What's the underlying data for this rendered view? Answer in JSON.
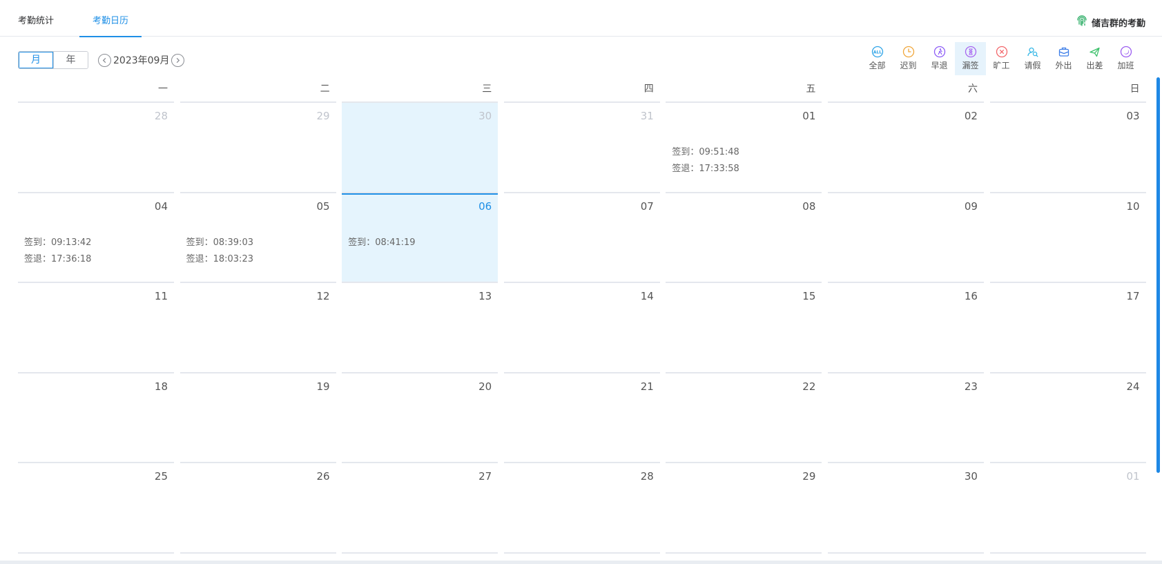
{
  "tabs": [
    {
      "label": "考勤统计"
    },
    {
      "label": "考勤日历"
    }
  ],
  "owner_label": "储吉群的考勤",
  "view_toggle": {
    "month": "月",
    "year": "年",
    "selected": "月"
  },
  "month_label": "2023年09月",
  "filters": [
    {
      "label": "全部",
      "icon": "all-icon",
      "color": "#2fa4e7",
      "active": false
    },
    {
      "label": "迟到",
      "icon": "clock-icon",
      "color": "#f0a63a",
      "active": false
    },
    {
      "label": "早退",
      "icon": "running-icon",
      "color": "#8d5cf6",
      "active": false
    },
    {
      "label": "漏签",
      "icon": "hourglass-icon",
      "color": "#a865f0",
      "active": true
    },
    {
      "label": "旷工",
      "icon": "close-circle-icon",
      "color": "#f2666a",
      "active": false
    },
    {
      "label": "请假",
      "icon": "search-person-icon",
      "color": "#37b7e6",
      "active": false
    },
    {
      "label": "外出",
      "icon": "briefcase-icon",
      "color": "#3d7ee8",
      "active": false
    },
    {
      "label": "出差",
      "icon": "plane-icon",
      "color": "#3cc06a",
      "active": false
    },
    {
      "label": "加班",
      "icon": "moon-icon",
      "color": "#9b5cf0",
      "active": false
    }
  ],
  "weekdays": [
    "一",
    "二",
    "三",
    "四",
    "五",
    "六",
    "日"
  ],
  "weeks": [
    [
      {
        "day": "28",
        "other": true
      },
      {
        "day": "29",
        "other": true
      },
      {
        "day": "30",
        "other": true,
        "selected": true
      },
      {
        "day": "31",
        "other": true
      },
      {
        "day": "01",
        "records": [
          "签到：09:51:48",
          "签退：17:33:58"
        ]
      },
      {
        "day": "02"
      },
      {
        "day": "03"
      }
    ],
    [
      {
        "day": "04",
        "records": [
          "签到：09:13:42",
          "签退：17:36:18"
        ]
      },
      {
        "day": "05",
        "records": [
          "签到：08:39:03",
          "签退：18:03:23"
        ]
      },
      {
        "day": "06",
        "today": true,
        "records": [
          "签到：08:41:19"
        ]
      },
      {
        "day": "07"
      },
      {
        "day": "08"
      },
      {
        "day": "09"
      },
      {
        "day": "10"
      }
    ],
    [
      {
        "day": "11"
      },
      {
        "day": "12"
      },
      {
        "day": "13"
      },
      {
        "day": "14"
      },
      {
        "day": "15"
      },
      {
        "day": "16"
      },
      {
        "day": "17"
      }
    ],
    [
      {
        "day": "18"
      },
      {
        "day": "19"
      },
      {
        "day": "20"
      },
      {
        "day": "21"
      },
      {
        "day": "22"
      },
      {
        "day": "23"
      },
      {
        "day": "24"
      }
    ],
    [
      {
        "day": "25"
      },
      {
        "day": "26"
      },
      {
        "day": "27"
      },
      {
        "day": "28"
      },
      {
        "day": "29"
      },
      {
        "day": "30"
      },
      {
        "day": "01",
        "other": true
      }
    ]
  ]
}
